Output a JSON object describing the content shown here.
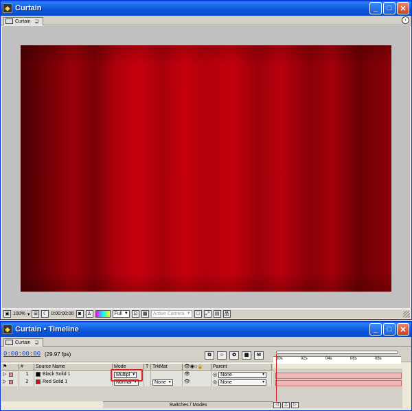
{
  "comp_window": {
    "title": "Curtain",
    "tab": {
      "label": "Curtain",
      "mark": "⊒"
    },
    "toolbar": {
      "zoom": "100%",
      "timecode": "0:00:00:00",
      "resolution": "Full",
      "view": "Active Camera"
    }
  },
  "timeline_window": {
    "title": "Curtain • Timeline",
    "tab": {
      "label": "Curtain",
      "mark": "⊒"
    },
    "current_time": "0:00:00:00",
    "fps": "(29.97 fps)",
    "columns": {
      "num": "#",
      "source": "Source Name",
      "mode": "Mode",
      "t": "T",
      "trkmat": "TrkMat",
      "parent": "Parent"
    },
    "layers": [
      {
        "num": "1",
        "name": "Black Solid 1",
        "color": "#000000",
        "mode": "Multipl",
        "trkmat": "",
        "parent": "None"
      },
      {
        "num": "2",
        "name": "Red Solid 1",
        "color": "#d41414",
        "mode": "Normal",
        "trkmat": "None",
        "parent": "None"
      }
    ],
    "ruler": [
      "00s",
      "02s",
      "04s",
      "06s",
      "08s"
    ],
    "switches_label": "Switches / Modes",
    "tool_m": "M"
  },
  "colors": {
    "accent": "#0b55d9",
    "label": "#e38a8a",
    "bar": "#f0b7b7",
    "cti": "#d71919"
  }
}
